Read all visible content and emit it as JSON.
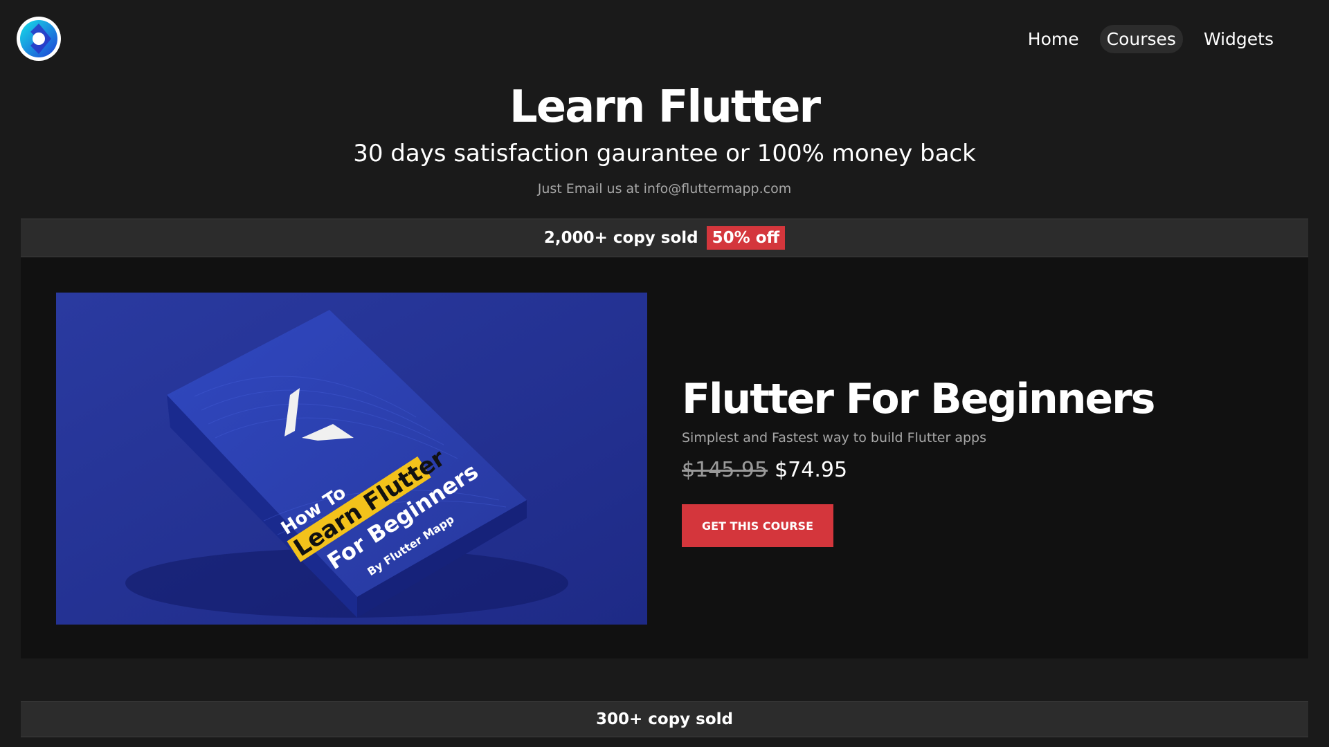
{
  "nav": {
    "items": [
      {
        "label": "Home",
        "active": false
      },
      {
        "label": "Courses",
        "active": true
      },
      {
        "label": "Widgets",
        "active": false
      }
    ]
  },
  "hero": {
    "title": "Learn Flutter",
    "subtitle": "30 days satisfaction gaurantee or 100% money back",
    "note": "Just Email us at info@fluttermapp.com"
  },
  "promo": {
    "sold_text": "2,000+ copy sold",
    "discount_badge": "50% off"
  },
  "course": {
    "cover": {
      "line1": "How To",
      "line2": "Learn Flutter",
      "line3": "For Beginners",
      "line4": "By Flutter Mapp"
    },
    "title": "Flutter For Beginners",
    "description": "Simplest and Fastest way to build Flutter apps",
    "old_price": "$145.95",
    "new_price": "$74.95",
    "cta_label": "GET THIS COURSE"
  },
  "promo2": {
    "sold_text": "300+ copy sold"
  },
  "colors": {
    "background": "#1a1a1a",
    "card": "#111111",
    "stripe": "#2c2c2c",
    "accent_red": "#d4363c",
    "cover_blue": "#24348f",
    "cover_highlight": "#f3c21b"
  },
  "icons": {
    "logo": "fluttermapp-logo"
  }
}
